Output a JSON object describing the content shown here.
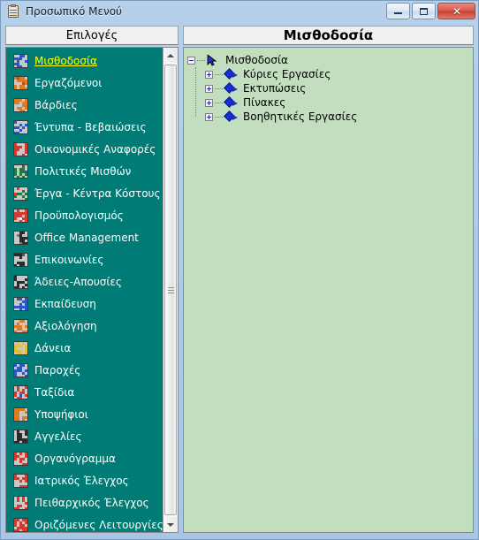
{
  "window": {
    "title": "Προσωπικό Μενού",
    "icon": "clipboard-icon",
    "buttons": {
      "minimize": "minimize-icon",
      "maximize": "maximize-icon",
      "close": "✕"
    }
  },
  "colors": {
    "titlebar": "#aecbe8",
    "list_background": "#017b75",
    "list_text": "#ffffff",
    "selected_text": "#ffff00",
    "tree_background": "#c2debf",
    "header_background": "#f0f0f0",
    "close_button": "#c5402f",
    "node_icon": "#1a2fd0"
  },
  "left_panel": {
    "header": "Επιλογές",
    "selected_index": 0,
    "items": [
      {
        "label": "Μισθοδοσία",
        "icon": "payroll-icon"
      },
      {
        "label": "Εργαζόμενοι",
        "icon": "employees-icon"
      },
      {
        "label": "Βάρδιες",
        "icon": "shifts-icon"
      },
      {
        "label": "Έντυπα - Βεβαιώσεις",
        "icon": "forms-icon"
      },
      {
        "label": "Οικονομικές Αναφορές",
        "icon": "financial-reports-icon"
      },
      {
        "label": "Πολιτικές Μισθών",
        "icon": "salary-policies-icon"
      },
      {
        "label": "Έργα - Κέντρα Κόστους",
        "icon": "projects-cost-centers-icon"
      },
      {
        "label": "Προϋπολογισμός",
        "icon": "budget-icon"
      },
      {
        "label": "Office Management",
        "icon": "office-management-icon"
      },
      {
        "label": "Επικοινωνίες",
        "icon": "communications-icon"
      },
      {
        "label": "Άδειες-Απουσίες",
        "icon": "leave-absence-icon"
      },
      {
        "label": "Εκπαίδευση",
        "icon": "training-icon"
      },
      {
        "label": "Αξιολόγηση",
        "icon": "evaluation-icon"
      },
      {
        "label": "Δάνεια",
        "icon": "loans-icon"
      },
      {
        "label": "Παροχές",
        "icon": "benefits-icon"
      },
      {
        "label": "Ταξίδια",
        "icon": "travel-icon"
      },
      {
        "label": "Υποψήφιοι",
        "icon": "candidates-icon"
      },
      {
        "label": "Αγγελίες",
        "icon": "job-ads-icon"
      },
      {
        "label": "Οργανόγραμμα",
        "icon": "org-chart-icon"
      },
      {
        "label": "Ιατρικός Έλεγχος",
        "icon": "medical-check-icon"
      },
      {
        "label": "Πειθαρχικός Έλεγχος",
        "icon": "disciplinary-check-icon"
      },
      {
        "label": "Οριζόμενες Λειτουργίες",
        "icon": "custom-functions-icon"
      }
    ],
    "scrollbar": {
      "up_arrow": "scroll-up-icon",
      "down_arrow": "scroll-down-icon"
    }
  },
  "right_panel": {
    "header": "Μισθοδοσία",
    "tree": {
      "root": {
        "label": "Μισθοδοσία",
        "state": "expanded",
        "expander": "minus"
      },
      "children": [
        {
          "label": "Κύριες Εργασίες",
          "state": "collapsed",
          "expander": "plus"
        },
        {
          "label": "Εκτυπώσεις",
          "state": "collapsed",
          "expander": "plus"
        },
        {
          "label": "Πίνακες",
          "state": "collapsed",
          "expander": "plus"
        },
        {
          "label": "Βοηθητικές Εργασίες",
          "state": "collapsed",
          "expander": "plus"
        }
      ]
    }
  }
}
